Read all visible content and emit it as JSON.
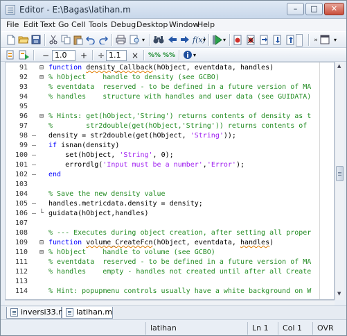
{
  "window": {
    "title": "Editor - E:\\Bagas\\latihan.m",
    "controls": {
      "minimize": "–",
      "maximize": "□",
      "close": "✕"
    }
  },
  "menu": [
    "File",
    "Edit",
    "Text",
    "Go",
    "Cell",
    "Tools",
    "Debug",
    "Desktop",
    "Window",
    "Help"
  ],
  "toolbar": {
    "icons": [
      "new-file-icon",
      "open-folder-icon",
      "save-icon",
      "cut-icon",
      "copy-icon",
      "paste-icon",
      "undo-icon",
      "redo-icon",
      "print-icon",
      "print-preview-icon",
      "find-icon",
      "back-icon",
      "forward-icon",
      "function-browser-icon",
      "run-icon",
      "set-breakpoint-icon",
      "clear-breakpoints-icon",
      "step-icon",
      "step-in-icon",
      "step-out-icon",
      "exit-debug-icon",
      "stack-icon",
      "dock-icon"
    ],
    "cell_minus": "−",
    "cell_value1": "1.0",
    "cell_plus": "+",
    "cell_divide": "÷",
    "cell_value2": "1.1",
    "cell_times": "×"
  },
  "code": {
    "lines": [
      {
        "n": "91",
        "mark": "",
        "fold": "⊟",
        "segments": [
          {
            "t": "function ",
            "c": "kw"
          },
          {
            "t": "density_Callback",
            "c": "ul"
          },
          {
            "t": "(hObject, eventdata, handles)",
            "c": ""
          }
        ]
      },
      {
        "n": "92",
        "mark": "",
        "fold": "⊟",
        "segments": [
          {
            "t": "% hObject    handle to density (see GCBO)",
            "c": "cm"
          }
        ]
      },
      {
        "n": "93",
        "mark": "",
        "fold": "",
        "segments": [
          {
            "t": "% eventdata  reserved - to be defined in a future version of MA",
            "c": "cm"
          }
        ]
      },
      {
        "n": "94",
        "mark": "",
        "fold": "",
        "segments": [
          {
            "t": "% handles    structure with handles and user data (see GUIDATA)",
            "c": "cm"
          }
        ]
      },
      {
        "n": "95",
        "mark": "",
        "fold": "",
        "segments": []
      },
      {
        "n": "96",
        "mark": "",
        "fold": "⊟",
        "segments": [
          {
            "t": "% Hints: get(hObject,'String') returns contents of density as t",
            "c": "cm"
          }
        ]
      },
      {
        "n": "97",
        "mark": "",
        "fold": "",
        "segments": [
          {
            "t": "%        str2double(get(hObject,'String')) returns contents of",
            "c": "cm"
          }
        ]
      },
      {
        "n": "98",
        "mark": "–",
        "fold": "",
        "segments": [
          {
            "t": "density = str2double(get(hObject, ",
            "c": ""
          },
          {
            "t": "'String'",
            "c": "st"
          },
          {
            "t": "));",
            "c": ""
          }
        ]
      },
      {
        "n": "99",
        "mark": "–",
        "fold": "",
        "segments": [
          {
            "t": "if ",
            "c": "kw"
          },
          {
            "t": "isnan(density)",
            "c": ""
          }
        ]
      },
      {
        "n": "100",
        "mark": "–",
        "fold": "",
        "segments": [
          {
            "t": "    set(hObject, ",
            "c": ""
          },
          {
            "t": "'String'",
            "c": "st"
          },
          {
            "t": ", 0);",
            "c": ""
          }
        ]
      },
      {
        "n": "101",
        "mark": "–",
        "fold": "",
        "segments": [
          {
            "t": "    errordlg(",
            "c": ""
          },
          {
            "t": "'Input must be a number'",
            "c": "st"
          },
          {
            "t": ",",
            "c": ""
          },
          {
            "t": "'Error'",
            "c": "st"
          },
          {
            "t": ");",
            "c": ""
          }
        ]
      },
      {
        "n": "102",
        "mark": "–",
        "fold": "",
        "segments": [
          {
            "t": "end",
            "c": "kw"
          }
        ]
      },
      {
        "n": "103",
        "mark": "",
        "fold": "",
        "segments": []
      },
      {
        "n": "104",
        "mark": "",
        "fold": "",
        "segments": [
          {
            "t": "% Save the new density value",
            "c": "cm"
          }
        ]
      },
      {
        "n": "105",
        "mark": "–",
        "fold": "",
        "segments": [
          {
            "t": "handles.metricdata.density = density;",
            "c": ""
          }
        ]
      },
      {
        "n": "106",
        "mark": "–",
        "fold": "└",
        "segments": [
          {
            "t": "guidata(hObject,handles)",
            "c": ""
          }
        ]
      },
      {
        "n": "107",
        "mark": "",
        "fold": "",
        "segments": []
      },
      {
        "n": "108",
        "mark": "",
        "fold": "",
        "segments": [
          {
            "t": "% --- Executes during object creation, after setting all proper",
            "c": "cm"
          }
        ]
      },
      {
        "n": "109",
        "mark": "",
        "fold": "⊟",
        "segments": [
          {
            "t": "function ",
            "c": "kw"
          },
          {
            "t": "volume_CreateFcn",
            "c": "ul"
          },
          {
            "t": "(hObject, eventdata, ",
            "c": ""
          },
          {
            "t": "handles",
            "c": "ul"
          },
          {
            "t": ")",
            "c": ""
          }
        ]
      },
      {
        "n": "110",
        "mark": "",
        "fold": "⊟",
        "segments": [
          {
            "t": "% hObject    handle to volume (see GCBO)",
            "c": "cm"
          }
        ]
      },
      {
        "n": "111",
        "mark": "",
        "fold": "",
        "segments": [
          {
            "t": "% eventdata  reserved - to be defined in a future version of MA",
            "c": "cm"
          }
        ]
      },
      {
        "n": "112",
        "mark": "",
        "fold": "",
        "segments": [
          {
            "t": "% handles    empty - handles not created until after all Create",
            "c": "cm"
          }
        ]
      },
      {
        "n": "113",
        "mark": "",
        "fold": "",
        "segments": []
      },
      {
        "n": "114",
        "mark": "",
        "fold": "",
        "segments": [
          {
            "t": "% Hint: popupmenu controls usually have a white background on W",
            "c": "cm"
          }
        ]
      }
    ]
  },
  "tabs": [
    {
      "label": "inversi33.m",
      "active": false
    },
    {
      "label": "latihan.m",
      "active": true
    }
  ],
  "status": {
    "file": "latihan",
    "line": "Ln  1",
    "col": "Col  1",
    "mode": "OVR"
  },
  "colors": {
    "keyword": "#0000ff",
    "comment": "#228b22",
    "string": "#a020f0",
    "warning_underline": "#e07b00"
  }
}
